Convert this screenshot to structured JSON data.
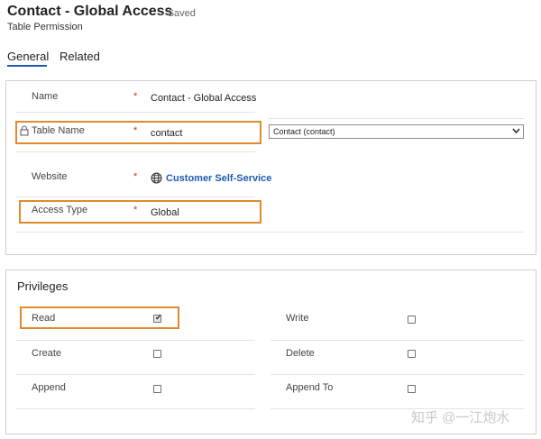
{
  "header": {
    "title": "Contact - Global Access",
    "status": "- Saved",
    "subtitle": "Table Permission"
  },
  "tabs": [
    {
      "label": "General",
      "active": true
    },
    {
      "label": "Related",
      "active": false
    }
  ],
  "general": {
    "required_marker": "*",
    "fields": {
      "name": {
        "label": "Name",
        "value": "Contact - Global Access"
      },
      "table_name": {
        "label": "Table Name",
        "value": "contact",
        "select_value": "Contact (contact)"
      },
      "website": {
        "label": "Website",
        "value": "Customer Self-Service"
      },
      "access_type": {
        "label": "Access Type",
        "value": "Global"
      }
    }
  },
  "privileges": {
    "title": "Privileges",
    "items": {
      "read": {
        "label": "Read",
        "checked": true
      },
      "write": {
        "label": "Write",
        "checked": false
      },
      "create": {
        "label": "Create",
        "checked": false
      },
      "delete": {
        "label": "Delete",
        "checked": false
      },
      "append": {
        "label": "Append",
        "checked": false
      },
      "append_to": {
        "label": "Append To",
        "checked": false
      }
    }
  },
  "icons": {
    "lock": "lock-icon",
    "globe": "globe-icon",
    "chevron": "chevron-down-icon",
    "check": "check-icon"
  },
  "colors": {
    "accent": "#1e5bb0",
    "highlight": "#e08a2c",
    "required": "#c0392b"
  },
  "watermark": "知乎 @一江炮水"
}
